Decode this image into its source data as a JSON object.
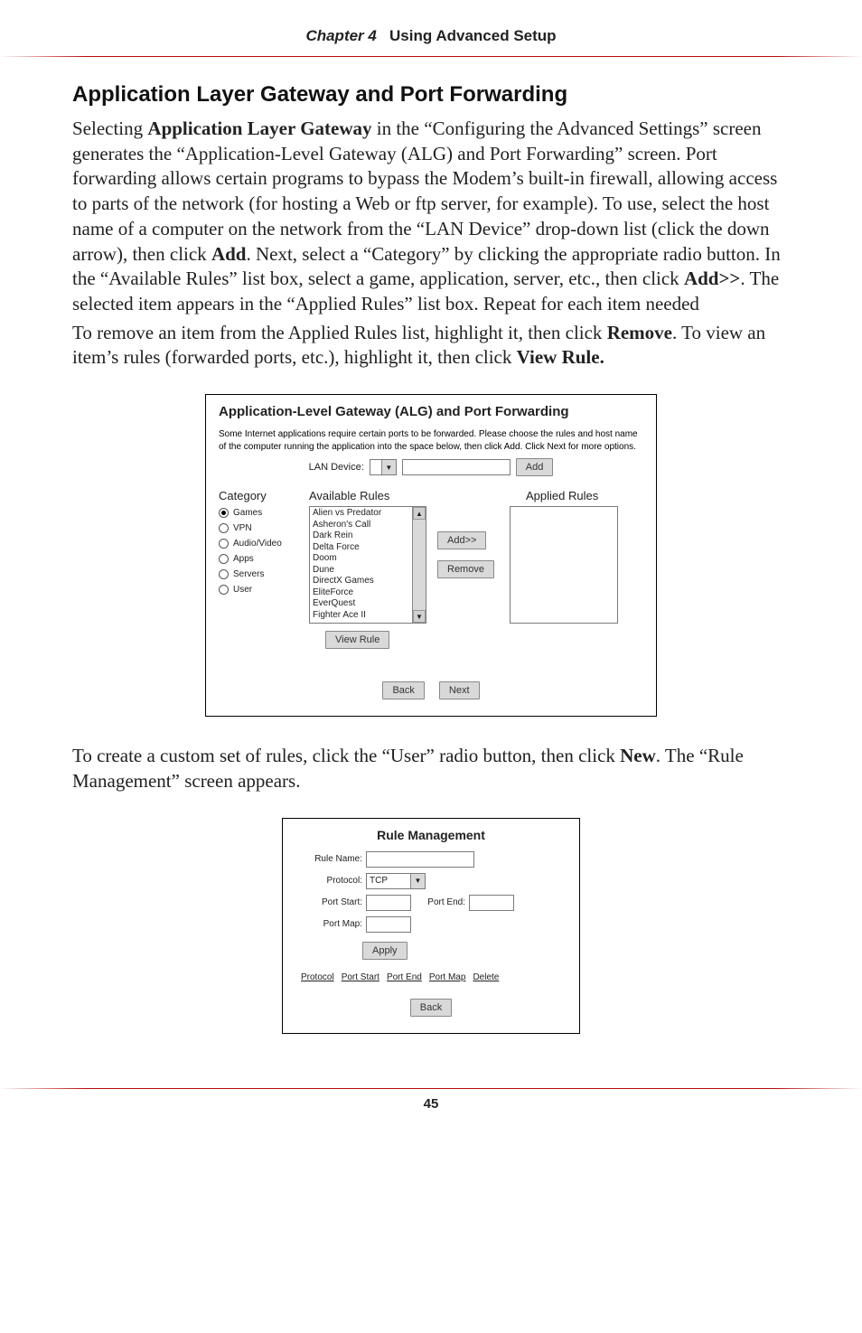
{
  "header": {
    "chapter": "Chapter 4",
    "title": "Using Advanced Setup"
  },
  "section_heading": "Application Layer Gateway and Port Forwarding",
  "para1_pre": "Selecting ",
  "para1_bold1": "Application Layer Gateway",
  "para1_mid1": " in the “Configuring the Advanced Settings” screen generates the “Application-Level Gateway (",
  "para1_sc1": "ALG",
  "para1_mid1b": ") and Port Forwarding” screen. Port forwarding allows certain programs to bypass the Modem’s built-in firewall, allowing access to parts of the network (for hosting a Web or ftp server, for example). To use, select the host name of a computer on the network from the “",
  "para1_sc2": "LAN",
  "para1_mid2": " Device” drop-down list (click the down arrow), then click ",
  "para1_bold2": "Add",
  "para1_mid3": ". Next, select a “Category” by clicking the appropriate radio button. In the “Available Rules” list box, select a game, application, server, etc., then click ",
  "para1_bold3": "Add>>",
  "para1_mid4": ". The selected item appears in the “Applied Rules” list box. Repeat for each item needed",
  "para2_pre": "To remove an item from the Applied Rules list, highlight it, then click ",
  "para2_bold": "Remove",
  "para2_mid": ". To view an item’s rules (forwarded ports, etc.), highlight it, then click ",
  "para2_bold2": "View Rule.",
  "fig1": {
    "title": "Application-Level Gateway (ALG) and Port Forwarding",
    "intro": "Some Internet applications require certain ports to be forwarded. Please choose the rules and host name of the computer running the application into the space below, then click Add. Click Next for more options.",
    "lan_label": "LAN Device:",
    "add_btn": "Add",
    "category": "Category",
    "available": "Available Rules",
    "applied": "Applied Rules",
    "cats": [
      "Games",
      "VPN",
      "Audio/Video",
      "Apps",
      "Servers",
      "User"
    ],
    "rules": [
      "Alien vs Predator",
      "Asheron's Call",
      "Dark Rein",
      "Delta Force",
      "Doom",
      "Dune",
      "DirectX Games",
      "EliteForce",
      "EverQuest",
      "Fighter Ace II"
    ],
    "add2_btn": "Add>>",
    "remove_btn": "Remove",
    "viewrule_btn": "View Rule",
    "back_btn": "Back",
    "next_btn": "Next"
  },
  "para3_pre": "To create a custom set of rules, click the “User” radio button, then click ",
  "para3_bold": "New",
  "para3_post": ". The “Rule Management” screen appears.",
  "fig2": {
    "title": "Rule Management",
    "rule_name": "Rule Name:",
    "protocol": "Protocol:",
    "protocol_val": "TCP",
    "port_start": "Port Start:",
    "port_end": "Port End:",
    "port_map": "Port Map:",
    "apply_btn": "Apply",
    "tbl": [
      "Protocol",
      "Port Start",
      "Port End",
      "Port Map",
      "Delete"
    ],
    "back_btn": "Back"
  },
  "page_number": "45"
}
